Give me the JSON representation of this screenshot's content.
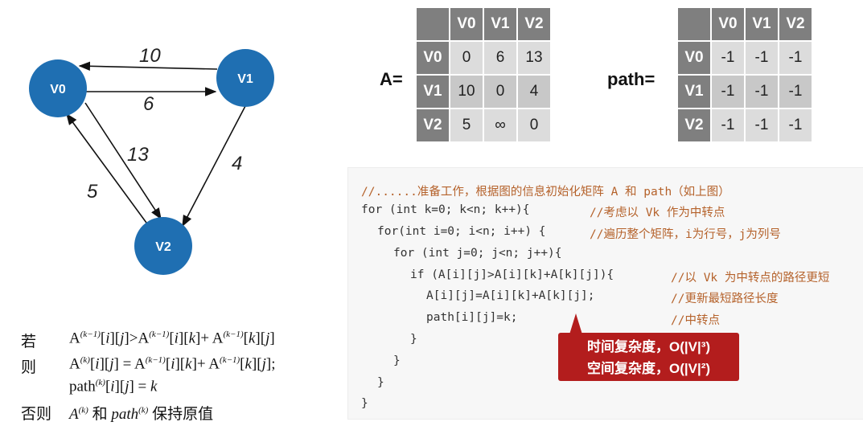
{
  "graph": {
    "nodes": [
      {
        "id": "n0",
        "label": "V0"
      },
      {
        "id": "n1",
        "label": "V1"
      },
      {
        "id": "n2",
        "label": "V2"
      }
    ],
    "edges": [
      {
        "from": "V1",
        "to": "V0",
        "weight": "10"
      },
      {
        "from": "V0",
        "to": "V1",
        "weight": "6"
      },
      {
        "from": "V0",
        "to": "V2",
        "weight": "13"
      },
      {
        "from": "V1",
        "to": "V2",
        "weight": "4"
      },
      {
        "from": "V2",
        "to": "V0",
        "weight": "5"
      }
    ],
    "node_color": "#1f6fb2"
  },
  "matrix_a": {
    "label": "A=",
    "headers": [
      "V0",
      "V1",
      "V2"
    ],
    "rows": [
      {
        "head": "V0",
        "cells": [
          "0",
          "6",
          "13"
        ]
      },
      {
        "head": "V1",
        "cells": [
          "10",
          "0",
          "4"
        ]
      },
      {
        "head": "V2",
        "cells": [
          "5",
          "∞",
          "0"
        ]
      }
    ]
  },
  "matrix_path": {
    "label": "path=",
    "headers": [
      "V0",
      "V1",
      "V2"
    ],
    "rows": [
      {
        "head": "V0",
        "cells": [
          "-1",
          "-1",
          "-1"
        ]
      },
      {
        "head": "V1",
        "cells": [
          "-1",
          "-1",
          "-1"
        ]
      },
      {
        "head": "V2",
        "cells": [
          "-1",
          "-1",
          "-1"
        ]
      }
    ]
  },
  "code": {
    "line1": "//......准备工作，根据图的信息初始化矩阵 A 和 path（如上图）",
    "line2_code": "for (int k=0; k<n; k++){",
    "line2_comment": "//考虑以 Vk 作为中转点",
    "line3_code": "for(int i=0; i<n; i++) {",
    "line3_comment": "//遍历整个矩阵，i为行号，j为列号",
    "line4_code": "for (int j=0; j<n; j++){",
    "line5_code": "if (A[i][j]>A[i][k]+A[k][j]){",
    "line5_comment": "//以 Vk 为中转点的路径更短",
    "line6_code": "A[i][j]=A[i][k]+A[k][j];",
    "line6_comment": "//更新最短路径长度",
    "line7_code": "path[i][j]=k;",
    "line7_comment": "//中转点",
    "close": "}"
  },
  "callout": {
    "time": "时间复杂度，O(|V|³)",
    "space": "空间复杂度，O(|V|²)",
    "color": "#b31d1d"
  },
  "formula": {
    "if_word": "若",
    "then_word": "则",
    "else_word": "否则",
    "hold_text": "和",
    "keep_text": "保持原值"
  }
}
